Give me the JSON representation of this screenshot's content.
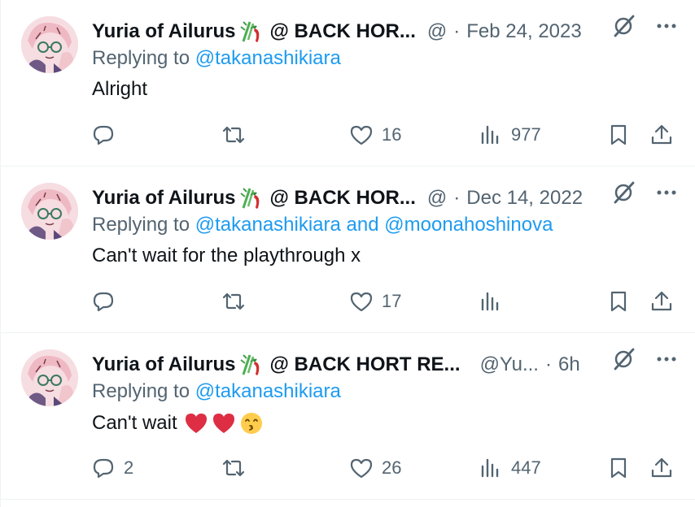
{
  "tweets": [
    {
      "author_name": "Yuria of Ailurus",
      "name_suffix": "@ BACK HOR...",
      "handle": "@",
      "separator": "·",
      "time": "Feb 24, 2023",
      "replying_prefix": "Replying to",
      "mentions": "@takanashikiara",
      "mentions_joiner": "",
      "mentions_2": "",
      "text": "Alright",
      "reply_count": "",
      "retweet_count": "",
      "like_count": "16",
      "view_count": "977"
    },
    {
      "author_name": "Yuria of Ailurus",
      "name_suffix": "@ BACK HOR...",
      "handle": "@",
      "separator": "·",
      "time": "Dec 14, 2022",
      "replying_prefix": "Replying to",
      "mentions": "@takanashikiara",
      "mentions_joiner": " and ",
      "mentions_2": "@moonahoshinova",
      "text": "Can't wait for the playthrough x",
      "reply_count": "",
      "retweet_count": "",
      "like_count": "17",
      "view_count": ""
    },
    {
      "author_name": "Yuria of Ailurus",
      "name_suffix": "@ BACK HORT RE...",
      "handle": "@Yu...",
      "separator": "·",
      "time": "6h",
      "replying_prefix": "Replying to",
      "mentions": "@takanashikiara",
      "mentions_joiner": "",
      "mentions_2": "",
      "text": "Can't wait",
      "reply_count": "2",
      "retweet_count": "",
      "like_count": "26",
      "view_count": "447"
    }
  ],
  "icons": {
    "reply": "reply-bubble-icon",
    "retweet": "retweet-icon",
    "like": "heart-outline-icon",
    "views": "bar-chart-icon",
    "bookmark": "bookmark-icon",
    "share": "share-upload-icon",
    "grok": "grok-slash-icon",
    "more": "more-dots-icon"
  },
  "colors": {
    "text": "#0f1419",
    "secondary": "#536471",
    "link": "#1d9bf0",
    "divider": "#eff3f4",
    "heart_emoji": "#dd2e44"
  }
}
